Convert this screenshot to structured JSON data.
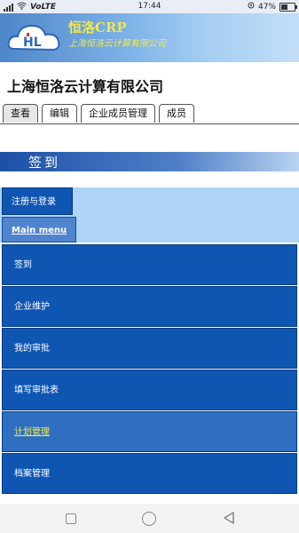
{
  "status": {
    "network": "VoLTE",
    "time": "17:44",
    "battery": "47%",
    "battery_level": 0.47
  },
  "header": {
    "brand": "恒洛CRP",
    "subtitle": "上海恒洛云计算有限公司"
  },
  "company_name": "上海恒洛云计算有限公司",
  "tabs": [
    {
      "label": "查看",
      "active": true
    },
    {
      "label": "编辑"
    },
    {
      "label": "企业成员管理"
    },
    {
      "label": "成员"
    }
  ],
  "page_title": "签到",
  "register_login": "注册与登录",
  "main_menu": "Main menu",
  "menu": [
    {
      "label": "签到"
    },
    {
      "label": "企业维护"
    },
    {
      "label": "我的审批"
    },
    {
      "label": "填写审批表"
    },
    {
      "label": "计划管理",
      "highlighted": true
    },
    {
      "label": "档案管理"
    }
  ],
  "colors": {
    "menu_bg": "#0f56b2",
    "highlight_text": "#f1ea52",
    "brand_text": "#f4e64a"
  }
}
